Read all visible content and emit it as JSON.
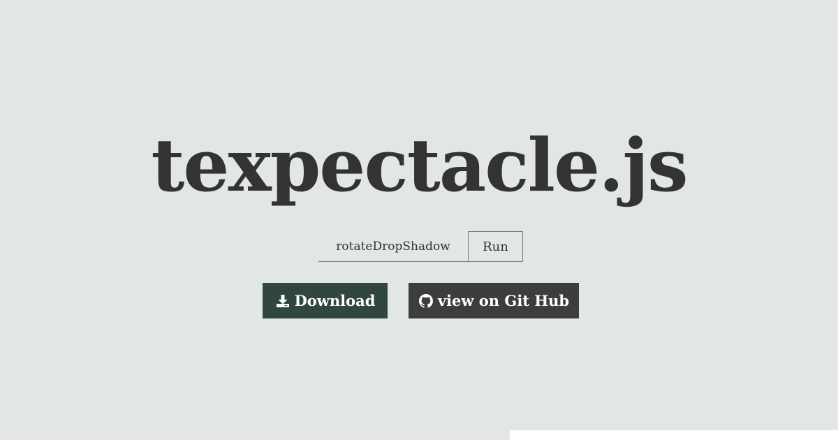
{
  "page": {
    "title": "texpectacle.js"
  },
  "effect_form": {
    "input_value": "rotateDropShadow",
    "run_label": "Run"
  },
  "actions": {
    "download_label": "Download",
    "github_label": "view on Git Hub",
    "download_icon": "download-icon",
    "github_icon": "github-icon"
  },
  "colors": {
    "background": "#e2e6e5",
    "title_text": "#333333",
    "download_button": "#314641",
    "github_button": "#3d3d3d"
  }
}
